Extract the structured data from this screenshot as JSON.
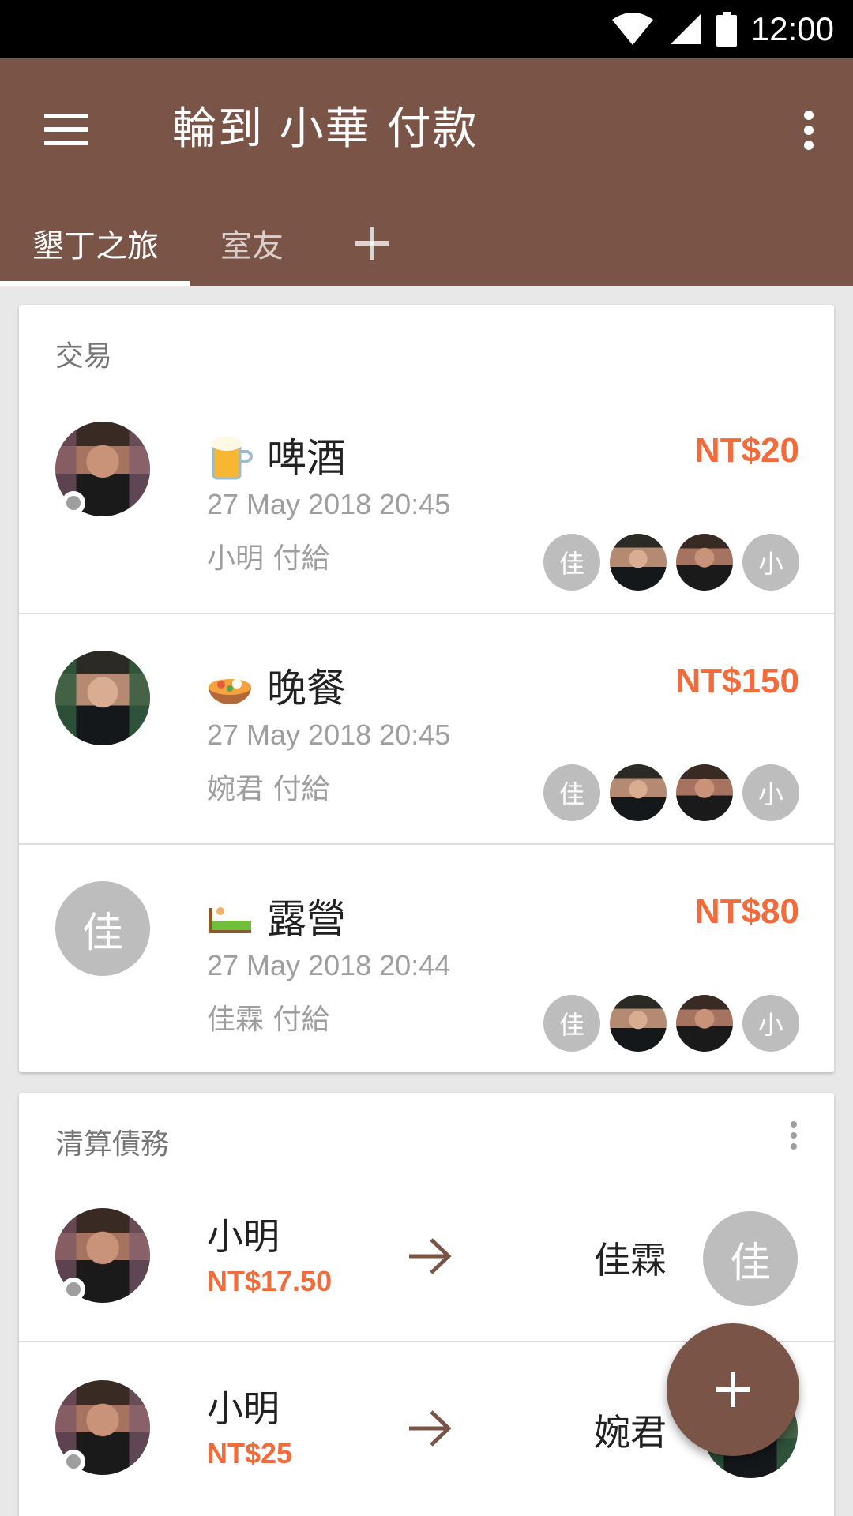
{
  "status_bar": {
    "time": "12:00",
    "icons": [
      "wifi-icon",
      "signal-icon",
      "battery-icon"
    ]
  },
  "app_bar": {
    "title": "輪到 小華 付款"
  },
  "tabs": [
    {
      "label": "墾丁之旅",
      "active": true
    },
    {
      "label": "室友",
      "active": false
    }
  ],
  "transactions": {
    "header": "交易",
    "items": [
      {
        "emoji": "beer-mug-icon",
        "title": "啤酒",
        "date": "27 May 2018 20:45",
        "paid_by": "小明 付給",
        "amount": "NT$20",
        "participants": [
          "佳",
          "photo-b",
          "photo-a",
          "小"
        ]
      },
      {
        "emoji": "food-bowl-icon",
        "title": "晚餐",
        "date": "27 May 2018 20:45",
        "paid_by": "婉君 付給",
        "amount": "NT$150",
        "participants": [
          "佳",
          "photo-b",
          "photo-a",
          "小"
        ]
      },
      {
        "emoji": "bed-icon",
        "title": "露營",
        "date": "27 May 2018 20:44",
        "paid_by": "佳霖 付給",
        "amount": "NT$80",
        "payer_letter": "佳",
        "participants": [
          "佳",
          "photo-b",
          "photo-a",
          "小"
        ]
      }
    ]
  },
  "settle": {
    "header": "清算債務",
    "items": [
      {
        "from": "小明",
        "amount": "NT$17.50",
        "to": "佳霖",
        "to_letter": "佳"
      },
      {
        "from": "小明",
        "amount": "NT$25",
        "to": "婉君"
      }
    ]
  },
  "colors": {
    "primary": "#7a5547",
    "accent": "#f26b3a",
    "avatar_grey": "#bdbdbd"
  }
}
